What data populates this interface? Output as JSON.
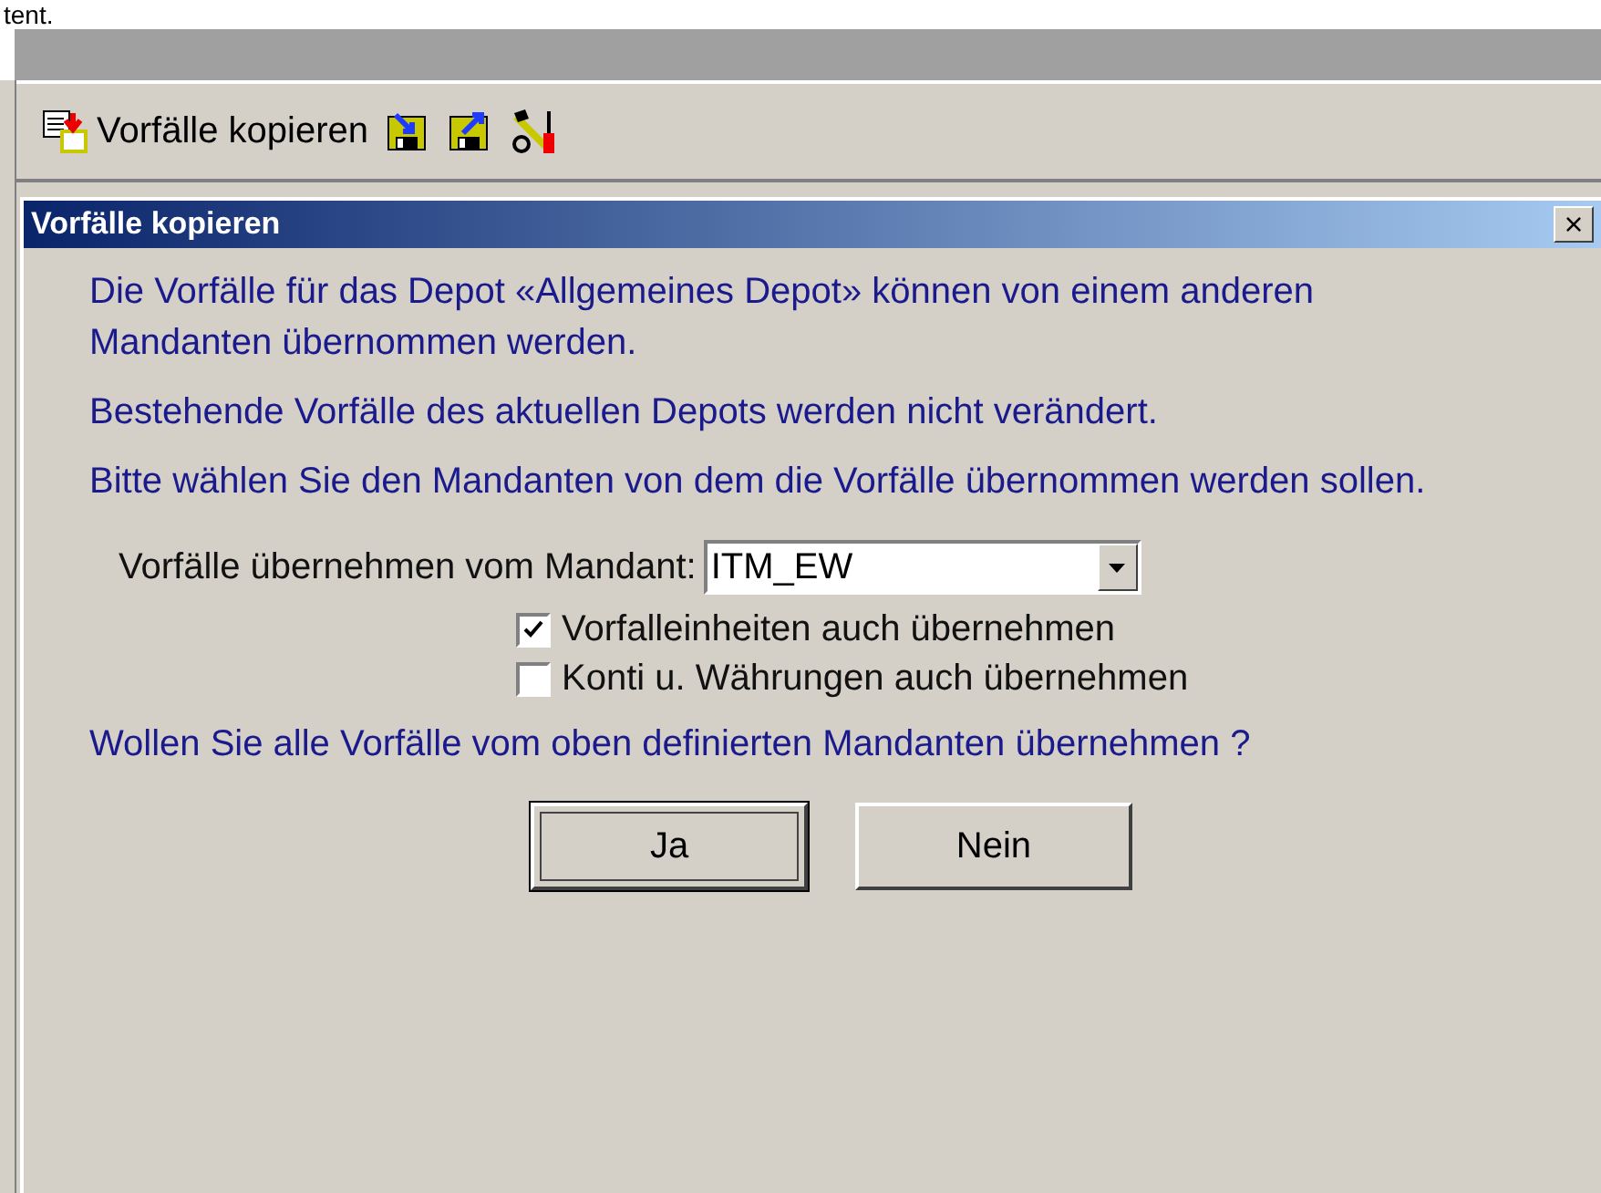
{
  "page_fragment": "tent.",
  "toolbar": {
    "copy_label": "Vorfälle kopieren"
  },
  "dialog": {
    "title": "Vorfälle kopieren",
    "close": "×",
    "paragraphs": [
      "Die Vorfälle für das Depot «Allgemeines Depot» können von einem anderen Mandanten übernommen werden.",
      "Bestehende  Vorfälle des aktuellen Depots werden nicht  verändert.",
      "Bitte wählen Sie den Mandanten von dem die Vorfälle übernommen werden sollen."
    ],
    "mandant_label": "Vorfälle übernehmen vom Mandant:",
    "mandant_value": "ITM_EW",
    "options": [
      {
        "label": "Vorfalleinheiten auch übernehmen",
        "checked": true
      },
      {
        "label": "Konti u. Währungen auch übernehmen",
        "checked": false
      }
    ],
    "question": "Wollen Sie alle Vorfälle vom oben definierten Mandanten übernehmen ?",
    "buttons": [
      {
        "label": "Ja",
        "default": true
      },
      {
        "label": "Nein",
        "default": false
      }
    ]
  }
}
